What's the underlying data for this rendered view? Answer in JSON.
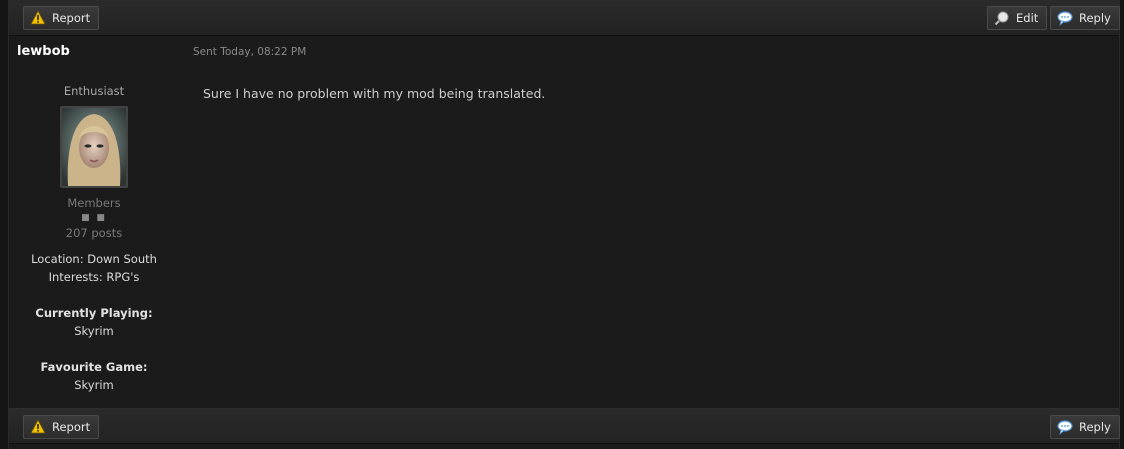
{
  "toolbar_top": {
    "report_label": "Report",
    "edit_label": "Edit",
    "reply_label": "Reply"
  },
  "post": {
    "author": "lewbob",
    "sent": "Sent Today, 08:22 PM",
    "body": "Sure I have no problem with my mod being translated."
  },
  "profile": {
    "rank": "Enthusiast",
    "group": "Members",
    "pips": "■ ■",
    "posts": "207 posts",
    "location": "Location: Down South",
    "interests": "Interests: RPG's",
    "currently_playing_label": "Currently Playing:",
    "currently_playing": "Skyrim",
    "favourite_game_label": "Favourite Game:",
    "favourite_game": "Skyrim"
  },
  "toolbar_bottom": {
    "report_label": "Report",
    "reply_label": "Reply"
  },
  "icons": {
    "report": "warning-icon",
    "edit": "edit-magnifier-icon",
    "reply": "speech-bubble-icon"
  },
  "colors": {
    "background": "#1b1b1b",
    "warning": "#f2c200",
    "reply_icon": "#4a8fd8"
  }
}
